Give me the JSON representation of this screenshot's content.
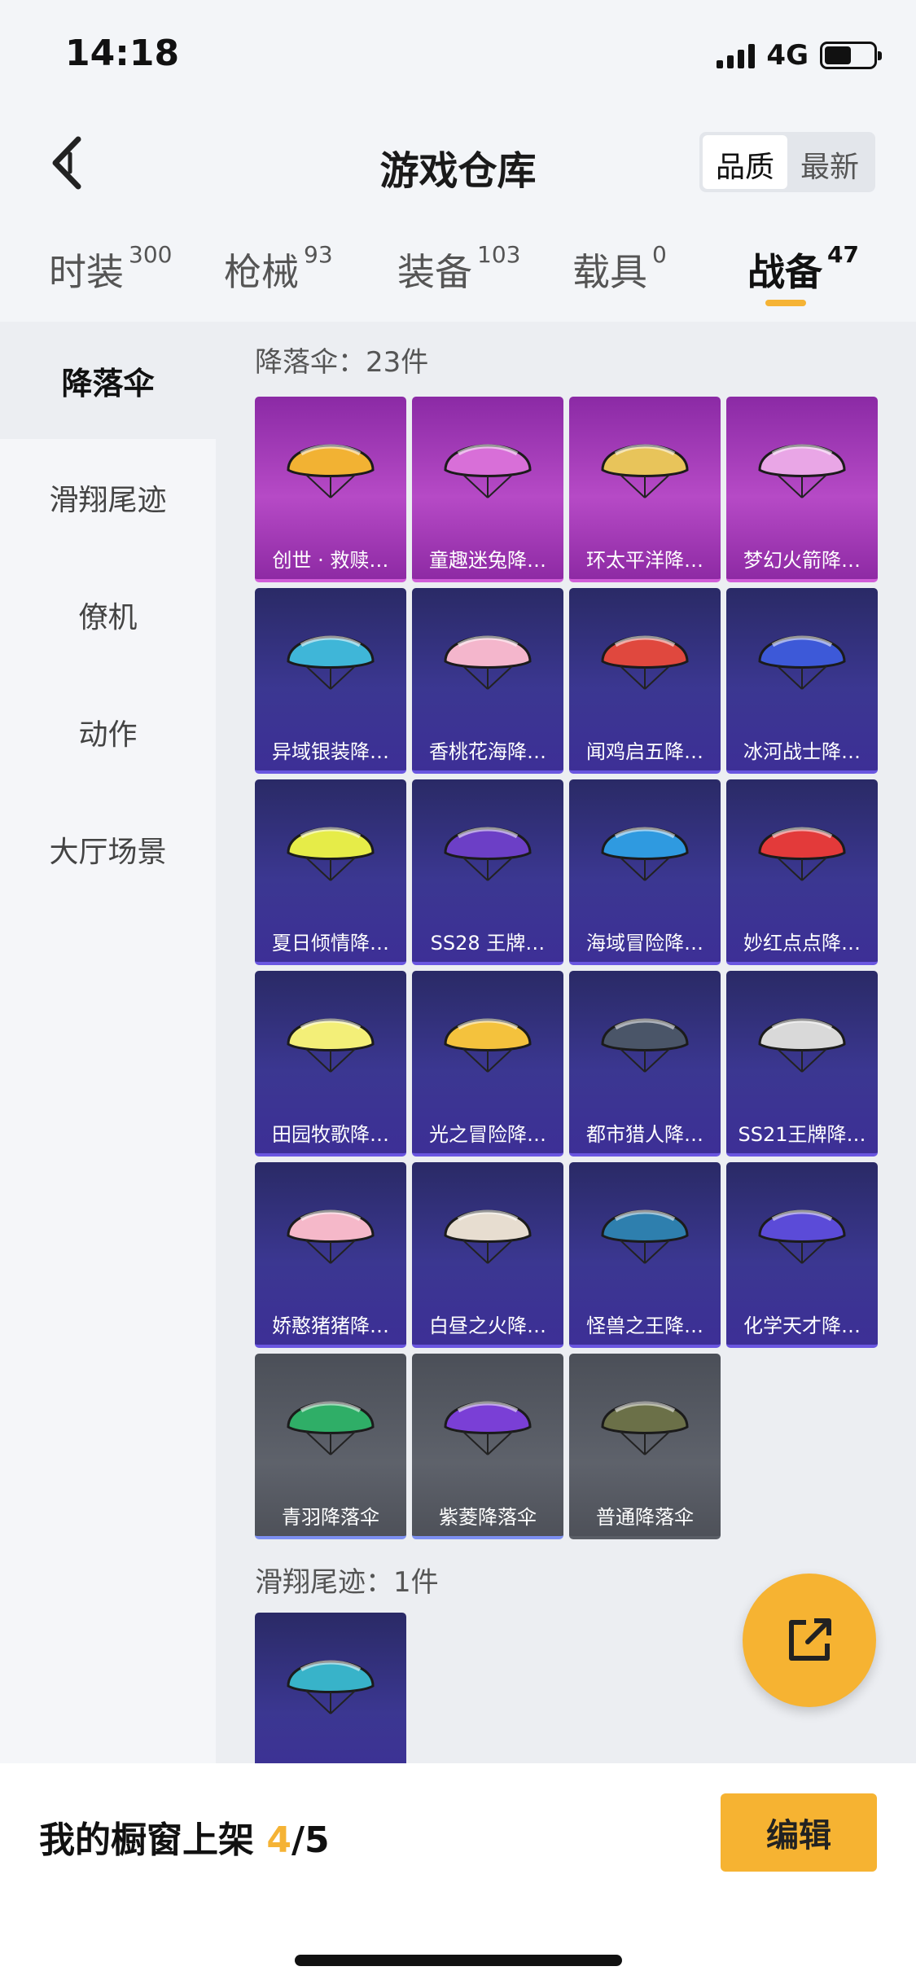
{
  "status_bar": {
    "time": "14:18",
    "network": "4G"
  },
  "header": {
    "title": "游戏仓库",
    "sort_options": [
      "品质",
      "最新"
    ],
    "sort_active": "品质"
  },
  "tabs": [
    {
      "label": "时装",
      "count": "300"
    },
    {
      "label": "枪械",
      "count": "93"
    },
    {
      "label": "装备",
      "count": "103"
    },
    {
      "label": "载具",
      "count": "0"
    },
    {
      "label": "战备",
      "count": "47"
    }
  ],
  "active_tab": "战备",
  "sidebar": {
    "items": [
      "降落伞",
      "滑翔尾迹",
      "僚机",
      "动作",
      "大厅场景"
    ],
    "active": "降落伞"
  },
  "sections": [
    {
      "title": "降落伞：23件",
      "items": [
        {
          "name": "创世 · 救赎…",
          "rarity": "legendary",
          "color": "#f2b233"
        },
        {
          "name": "童趣迷兔降…",
          "rarity": "legendary",
          "color": "#d86fd8"
        },
        {
          "name": "环太平洋降…",
          "rarity": "legendary",
          "color": "#e8c45a"
        },
        {
          "name": "梦幻火箭降…",
          "rarity": "legendary",
          "color": "#e9a6e6"
        },
        {
          "name": "异域银装降…",
          "rarity": "epic",
          "color": "#3fb6d8"
        },
        {
          "name": "香桃花海降…",
          "rarity": "epic",
          "color": "#f4b6cc"
        },
        {
          "name": "闻鸡启五降…",
          "rarity": "epic",
          "color": "#e0483e"
        },
        {
          "name": "冰河战士降…",
          "rarity": "epic",
          "color": "#3d59d8"
        },
        {
          "name": "夏日倾情降…",
          "rarity": "epic",
          "color": "#e6ec48"
        },
        {
          "name": "SS28 王牌…",
          "rarity": "epic",
          "color": "#6c3fc6"
        },
        {
          "name": "海域冒险降…",
          "rarity": "epic",
          "color": "#2f9ae0"
        },
        {
          "name": "妙红点点降…",
          "rarity": "epic",
          "color": "#e33a3a"
        },
        {
          "name": "田园牧歌降…",
          "rarity": "epic",
          "color": "#f3ef78"
        },
        {
          "name": "光之冒险降…",
          "rarity": "epic",
          "color": "#f4c23d"
        },
        {
          "name": "都市猎人降…",
          "rarity": "epic",
          "color": "#4a5568"
        },
        {
          "name": "SS21王牌降…",
          "rarity": "epic",
          "color": "#d9d9d9"
        },
        {
          "name": "娇憨猪猪降…",
          "rarity": "epic",
          "color": "#f5b8c9"
        },
        {
          "name": "白昼之火降…",
          "rarity": "epic",
          "color": "#e7ddd0"
        },
        {
          "name": "怪兽之王降…",
          "rarity": "epic",
          "color": "#2e7fae"
        },
        {
          "name": "化学天才降…",
          "rarity": "epic",
          "color": "#5b4bd8"
        },
        {
          "name": "青羽降落伞",
          "rarity": "rare",
          "color": "#2fae67"
        },
        {
          "name": "紫菱降落伞",
          "rarity": "rare",
          "color": "#7a3fd6"
        },
        {
          "name": "普通降落伞",
          "rarity": "common",
          "color": "#6b7048"
        }
      ]
    },
    {
      "title": "滑翔尾迹：1件",
      "items": [
        {
          "name": "",
          "rarity": "epic",
          "color": "#38b3c9"
        }
      ]
    }
  ],
  "bottom_bar": {
    "showcase_label": "我的橱窗上架",
    "showcase_count": "4",
    "showcase_total": "/5",
    "edit_label": "编辑"
  },
  "colors": {
    "accent": "#f6b332",
    "legendary": "#a63bbd",
    "epic": "#3b3791",
    "rare": "#5e626b"
  }
}
